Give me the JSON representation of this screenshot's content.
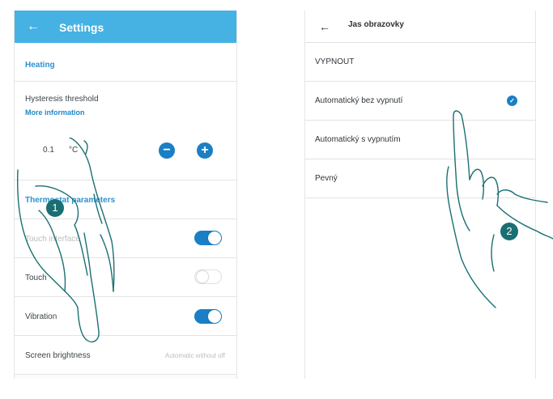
{
  "left_screen": {
    "header": {
      "back_icon": "←",
      "title": "Settings"
    },
    "heating_section": "Heating",
    "hysteresis": {
      "label": "Hysteresis threshold",
      "more_info": "More information",
      "value": "0.1",
      "unit": "°C",
      "minus_label": "−",
      "plus_label": "+"
    },
    "thermostat_section": "Thermostat parameters",
    "touch_interface": {
      "label": "Touch interface",
      "enabled": true
    },
    "touch2": {
      "label": "Touch",
      "enabled": false
    },
    "vibration": {
      "label": "Vibration",
      "enabled": true
    },
    "screen_brightness": {
      "label": "Screen brightness",
      "value": "Automatic without off"
    }
  },
  "right_screen": {
    "header": {
      "back_icon": "←",
      "title": "Jas obrazovky"
    },
    "options": [
      {
        "label": "VYPNOUT",
        "selected": false
      },
      {
        "label": "Automatický bez vypnutí",
        "selected": true
      },
      {
        "label": "Automatický s vypnutím",
        "selected": false
      },
      {
        "label": "Pevný",
        "selected": false
      }
    ],
    "check_icon": "✓"
  },
  "step_badges": [
    "1",
    "2"
  ],
  "colors": {
    "accent": "#45b2e3",
    "primary_blue": "#1a7fc4",
    "badge": "#1a6f73"
  }
}
